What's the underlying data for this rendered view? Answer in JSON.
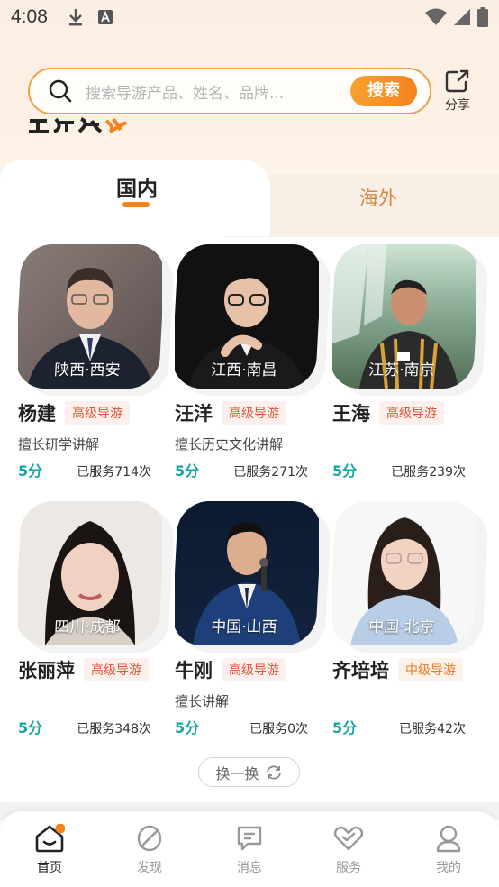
{
  "status_bar": {
    "time": "4:08"
  },
  "search": {
    "placeholder": "搜索导游产品、姓名、品牌...",
    "button_label": "搜索"
  },
  "share": {
    "label": "分享"
  },
  "tabs": [
    {
      "label": "国内",
      "active": true
    },
    {
      "label": "海外",
      "active": false
    }
  ],
  "guides": [
    {
      "location": "陕西·西安",
      "name": "杨建",
      "level": "高级导游",
      "specialty": "擅长研学讲解",
      "score": "5分",
      "served": "已服务714次"
    },
    {
      "location": "江西·南昌",
      "name": "汪洋",
      "level": "高级导游",
      "specialty": "擅长历史文化讲解",
      "score": "5分",
      "served": "已服务271次"
    },
    {
      "location": "江苏·南京",
      "name": "王海",
      "level": "高级导游",
      "specialty": "",
      "score": "5分",
      "served": "已服务239次"
    },
    {
      "location": "四川·成都",
      "name": "张丽萍",
      "level": "高级导游",
      "specialty": "",
      "score": "5分",
      "served": "已服务348次"
    },
    {
      "location": "中国·山西",
      "name": "牛刚",
      "level": "高级导游",
      "specialty": "擅长讲解",
      "score": "5分",
      "served": "已服务0次"
    },
    {
      "location": "中国·北京",
      "name": "齐培培",
      "level": "中级导游",
      "specialty": "",
      "score": "5分",
      "served": "已服务42次"
    }
  ],
  "refresh": {
    "label": "换一换"
  },
  "bottom_nav": [
    {
      "label": "首页",
      "icon": "home-icon",
      "active": true
    },
    {
      "label": "发现",
      "icon": "discover-icon",
      "active": false
    },
    {
      "label": "消息",
      "icon": "message-icon",
      "active": false
    },
    {
      "label": "服务",
      "icon": "service-icon",
      "active": false
    },
    {
      "label": "我的",
      "icon": "profile-icon",
      "active": false
    }
  ],
  "colors": {
    "accent": "#f5821f",
    "score": "#16a6a2",
    "level_senior": "#e0563a",
    "level_mid": "#ee7a2a"
  }
}
